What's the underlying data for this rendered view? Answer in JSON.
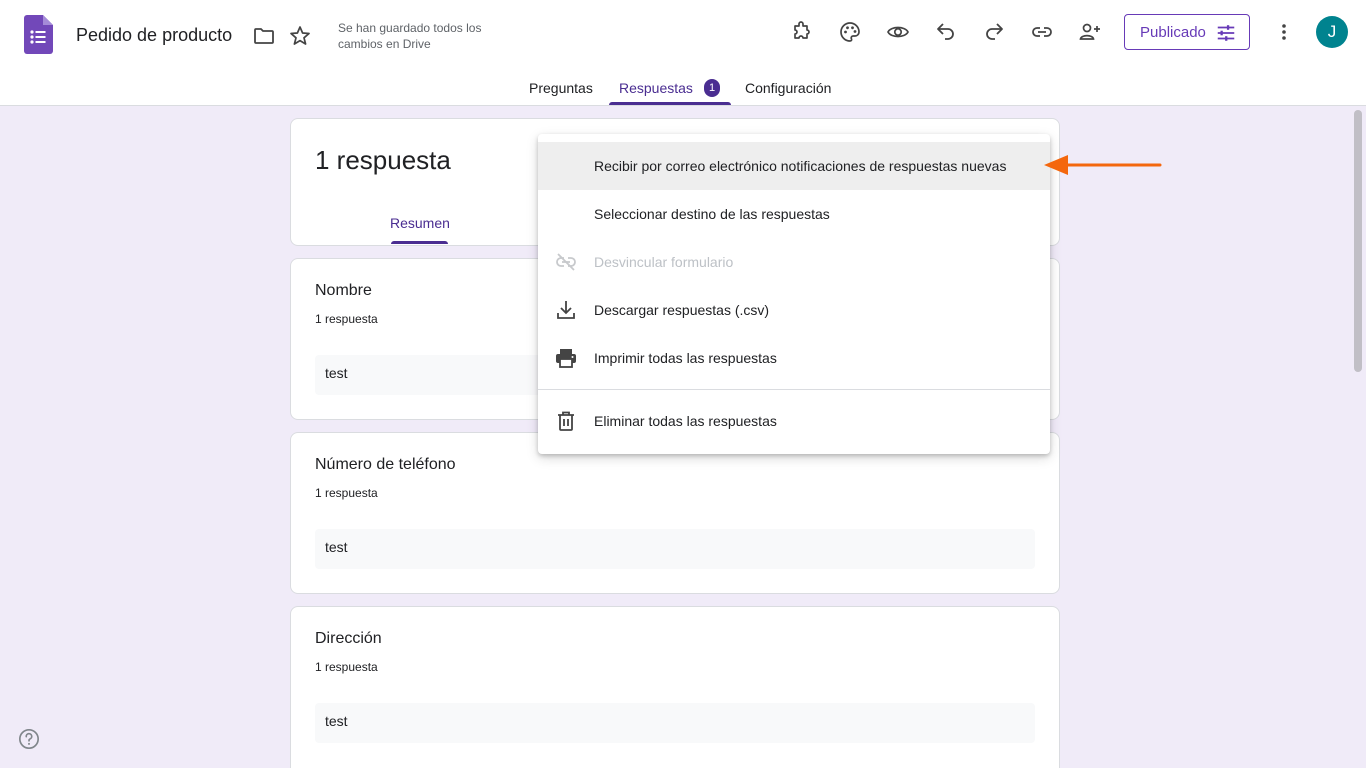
{
  "header": {
    "title": "Pedido de producto",
    "save_status": "Se han guardado todos los cambios en Drive",
    "publish_label": "Publicado",
    "avatar_initial": "J"
  },
  "tabs": [
    {
      "label": "Preguntas"
    },
    {
      "label": "Respuestas",
      "badge": "1"
    },
    {
      "label": "Configuración"
    }
  ],
  "summary": {
    "count_label": "1 respuesta",
    "tab_label": "Resumen"
  },
  "questions": [
    {
      "title": "Nombre",
      "count": "1 respuesta",
      "answer": "test"
    },
    {
      "title": "Número de teléfono",
      "count": "1 respuesta",
      "answer": "test"
    },
    {
      "title": "Dirección",
      "count": "1 respuesta",
      "answer": "test"
    }
  ],
  "menu": {
    "items": [
      {
        "label": "Recibir por correo electrónico notificaciones de respuestas nuevas",
        "icon": "none"
      },
      {
        "label": "Seleccionar destino de las respuestas",
        "icon": "none"
      },
      {
        "label": "Desvincular formulario",
        "icon": "link-off-icon",
        "disabled": true
      },
      {
        "label": "Descargar respuestas (.csv)",
        "icon": "download-icon"
      },
      {
        "label": "Imprimir todas las respuestas",
        "icon": "print-icon"
      },
      {
        "label": "Eliminar todas las respuestas",
        "icon": "trash-icon"
      }
    ]
  },
  "colors": {
    "accent": "#673ab7",
    "accent_dark": "#4a2d91",
    "background": "#f0ebf8",
    "annotation_arrow": "#f4670e",
    "avatar": "#00838f"
  }
}
